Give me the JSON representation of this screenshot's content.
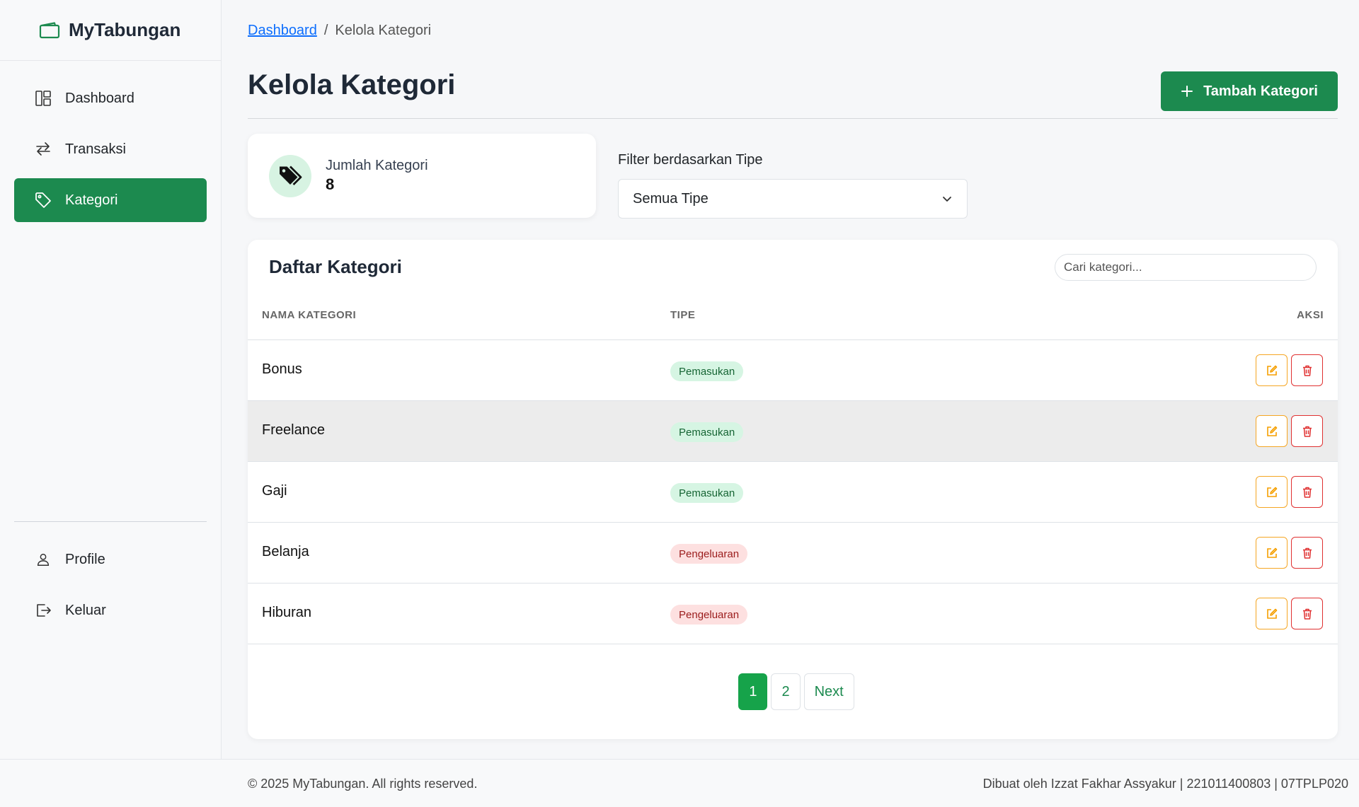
{
  "brand": {
    "name": "MyTabungan",
    "accent": "#1c8a4f"
  },
  "sidebar": {
    "items": [
      {
        "label": "Dashboard",
        "icon": "dashboard-icon"
      },
      {
        "label": "Transaksi",
        "icon": "transfer-arrows-icon"
      },
      {
        "label": "Kategori",
        "icon": "tag-icon",
        "active": true
      }
    ],
    "bottom_items": [
      {
        "label": "Profile",
        "icon": "user-icon"
      },
      {
        "label": "Keluar",
        "icon": "logout-icon"
      }
    ]
  },
  "breadcrumb": {
    "parent": "Dashboard",
    "separator": "/",
    "current": "Kelola Kategori"
  },
  "page": {
    "title": "Kelola Kategori",
    "add_button": "Tambah Kategori"
  },
  "stats": {
    "label": "Jumlah Kategori",
    "value": "8"
  },
  "filter": {
    "label": "Filter berdasarkan Tipe",
    "selected": "Semua Tipe"
  },
  "list": {
    "title": "Daftar Kategori",
    "search_placeholder": "Cari kategori...",
    "columns": {
      "name": "NAMA KATEGORI",
      "type": "TIPE",
      "action": "AKSI"
    },
    "rows": [
      {
        "name": "Bonus",
        "type": "Pemasukan",
        "kind": "in"
      },
      {
        "name": "Freelance",
        "type": "Pemasukan",
        "kind": "in"
      },
      {
        "name": "Gaji",
        "type": "Pemasukan",
        "kind": "in"
      },
      {
        "name": "Belanja",
        "type": "Pengeluaran",
        "kind": "out"
      },
      {
        "name": "Hiburan",
        "type": "Pengeluaran",
        "kind": "out"
      }
    ]
  },
  "pagination": {
    "pages": [
      "1",
      "2"
    ],
    "current": "1",
    "next": "Next"
  },
  "footer": {
    "copyright": "© 2025 MyTabungan. All rights reserved.",
    "credit": "Dibuat oleh Izzat Fakhar Assyakur | 221011400803 | 07TPLP020"
  }
}
